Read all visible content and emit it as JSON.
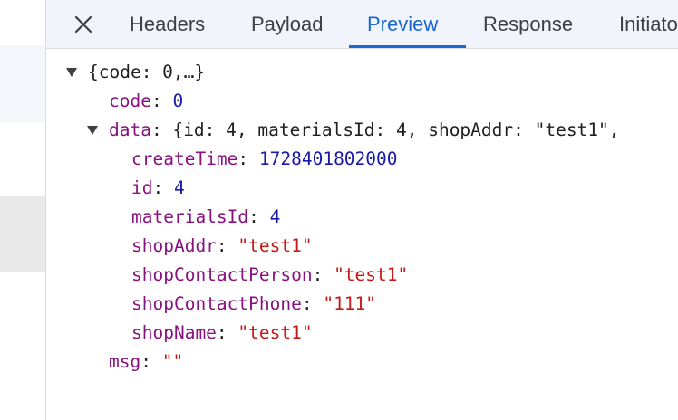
{
  "tabs": [
    {
      "label": "Headers"
    },
    {
      "label": "Payload"
    },
    {
      "label": "Preview"
    },
    {
      "label": "Response"
    },
    {
      "label": "Initiato"
    }
  ],
  "active_tab": "Preview",
  "icons": {
    "close": "close-icon",
    "expand": "triangle-down-icon"
  },
  "colors": {
    "accent": "#1a66d2",
    "key": "#881280",
    "number": "#1a1aa6",
    "string": "#c41a16"
  },
  "json": {
    "root_summary": "{code: 0,…}",
    "code": {
      "key": "code",
      "value": "0"
    },
    "data": {
      "key": "data",
      "summary": "{id: 4, materialsId: 4, shopAddr: \"test1\",",
      "fields": [
        {
          "key": "createTime",
          "value": "1728401802000",
          "type": "number"
        },
        {
          "key": "id",
          "value": "4",
          "type": "number"
        },
        {
          "key": "materialsId",
          "value": "4",
          "type": "number"
        },
        {
          "key": "shopAddr",
          "value": "\"test1\"",
          "type": "string"
        },
        {
          "key": "shopContactPerson",
          "value": "\"test1\"",
          "type": "string"
        },
        {
          "key": "shopContactPhone",
          "value": "\"111\"",
          "type": "string"
        },
        {
          "key": "shopName",
          "value": "\"test1\"",
          "type": "string"
        }
      ]
    },
    "msg": {
      "key": "msg",
      "value": "\"\""
    }
  }
}
